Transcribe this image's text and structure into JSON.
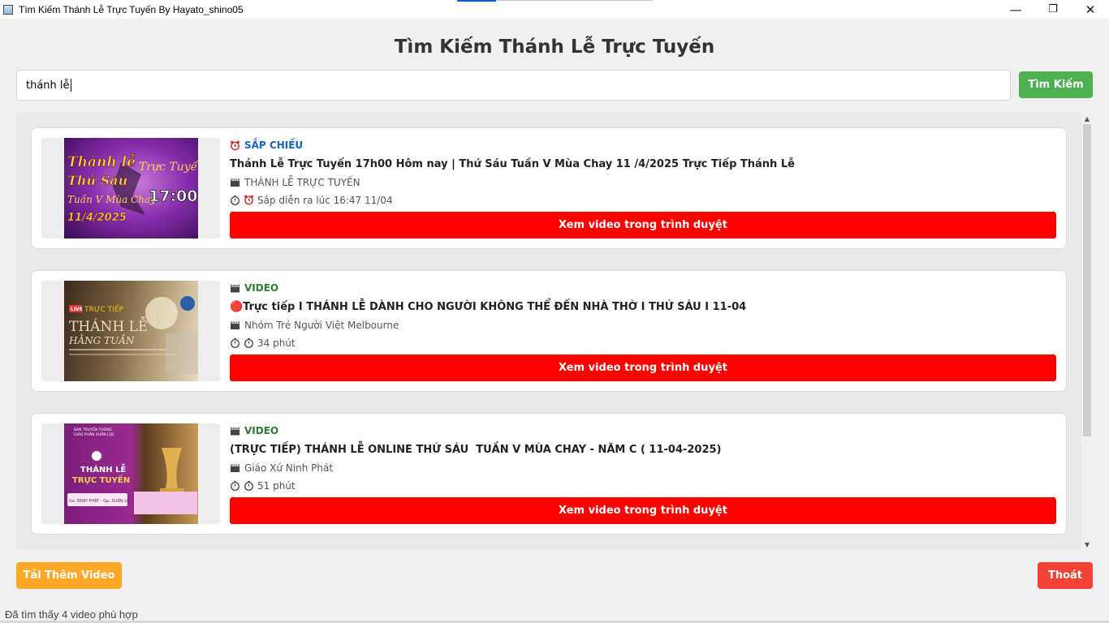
{
  "window": {
    "title": "Tìm Kiếm Thánh Lễ Trực Tuyến By Hayato_shino05",
    "minimize": "—",
    "maximize": "❐",
    "close": "✕"
  },
  "header": {
    "title": "Tìm Kiếm Thánh Lễ Trực Tuyến"
  },
  "search": {
    "value": "thánh lễ",
    "button_label": "Tìm Kiếm"
  },
  "results": [
    {
      "badge": "SẮP CHIẾU",
      "badge_icon": "alarm-clock-icon",
      "title": "Thánh Lễ Trực Tuyến 17h00 Hôm nay | Thứ Sáu Tuần V Mùa Chay 11 /4/2025 Trực Tiếp Thánh Lễ",
      "channel": "THÁNH LỄ TRỰC TUYẾN",
      "duration": "Sắp diễn ra lúc 16:47 11/04",
      "button": "Xem video trong trình duyệt",
      "thumb_text": {
        "l1": "Thánh lễ",
        "l2": "Trực Tuyến",
        "l3": "Thứ Sáu",
        "l4": "Tuần V Mùa Chay",
        "l5": "17:00",
        "l6": "11/4/2025"
      }
    },
    {
      "badge": "VIDEO",
      "badge_icon": "clapperboard-icon",
      "title": "🔴Trực tiếp I THÁNH LỄ DÀNH CHO NGƯỜI KHÔNG THỂ ĐẾN NHÀ THỜ I THỨ SÁU I 11-04",
      "channel": "Nhóm Trẻ Người Việt Melbourne",
      "duration": "34 phút",
      "button": "Xem video trong trình duyệt",
      "thumb_text": {
        "l1": "LIVE",
        "l2": "TRỰC TIẾP",
        "l3": "THÁNH LỄ",
        "l4": "HẰNG TUẦN"
      }
    },
    {
      "badge": "VIDEO",
      "badge_icon": "clapperboard-icon",
      "title": "(TRỰC TIẾP) THÁNH LỄ ONLINE THỨ SÁU  TUẦN V MÙA CHAY - NĂM C ( 11-04-2025)",
      "channel": "Giáo Xứ Ninh Phát",
      "duration": "51 phút",
      "button": "Xem video trong trình duyệt",
      "thumb_text": {
        "l1": "BAN TRUYỀN THÔNG",
        "l2": "GIÁO PHẬN XUÂN LỘC",
        "l3": "THÁNH LỄ",
        "l4": "TRỰC TUYẾN",
        "l5": "Gx. NINH PHÁT - Gp. XUÂN LỘC"
      }
    }
  ],
  "footer": {
    "load_more": "Tải Thêm Video",
    "exit": "Thoát",
    "status": "Đã tìm thấy 4 video phù hợp"
  },
  "colors": {
    "search_button": "#4caf50",
    "watch_button": "#ff0000",
    "load_more": "#ffa726",
    "exit": "#f44336",
    "badge_upcoming": "#1565c0",
    "badge_video": "#2e7d32"
  }
}
